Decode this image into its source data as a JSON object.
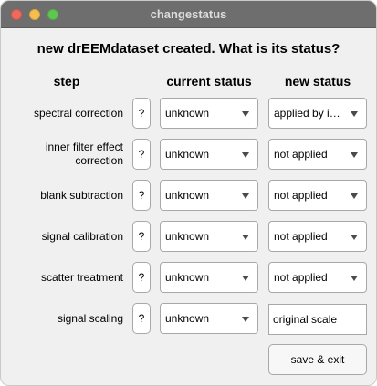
{
  "window": {
    "title": "changestatus",
    "controls": [
      "close-icon",
      "minimize-icon",
      "maximize-icon"
    ]
  },
  "question": "new drEEMdataset created. What is its status?",
  "headers": {
    "step": "step",
    "current": "current status",
    "new": "new status"
  },
  "help_label": "?",
  "rows": [
    {
      "label_lines": [
        "spectral correction"
      ],
      "current": "unknown",
      "new": "applied by i…"
    },
    {
      "label_lines": [
        "inner filter effect",
        "correction"
      ],
      "current": "unknown",
      "new": "not applied"
    },
    {
      "label_lines": [
        "blank subtraction"
      ],
      "current": "unknown",
      "new": "not applied"
    },
    {
      "label_lines": [
        "signal calibration"
      ],
      "current": "unknown",
      "new": "not applied"
    },
    {
      "label_lines": [
        "scatter treatment"
      ],
      "current": "unknown",
      "new": "not applied"
    },
    {
      "label_lines": [
        "signal scaling"
      ],
      "current": "unknown",
      "new_text_field": "original scale"
    }
  ],
  "save_label": "save & exit",
  "colors": {
    "titlebar": "#6e6e6e",
    "window_bg": "#f0f0f0",
    "control_bg": "#ffffff",
    "border": "#a8a8a8"
  }
}
